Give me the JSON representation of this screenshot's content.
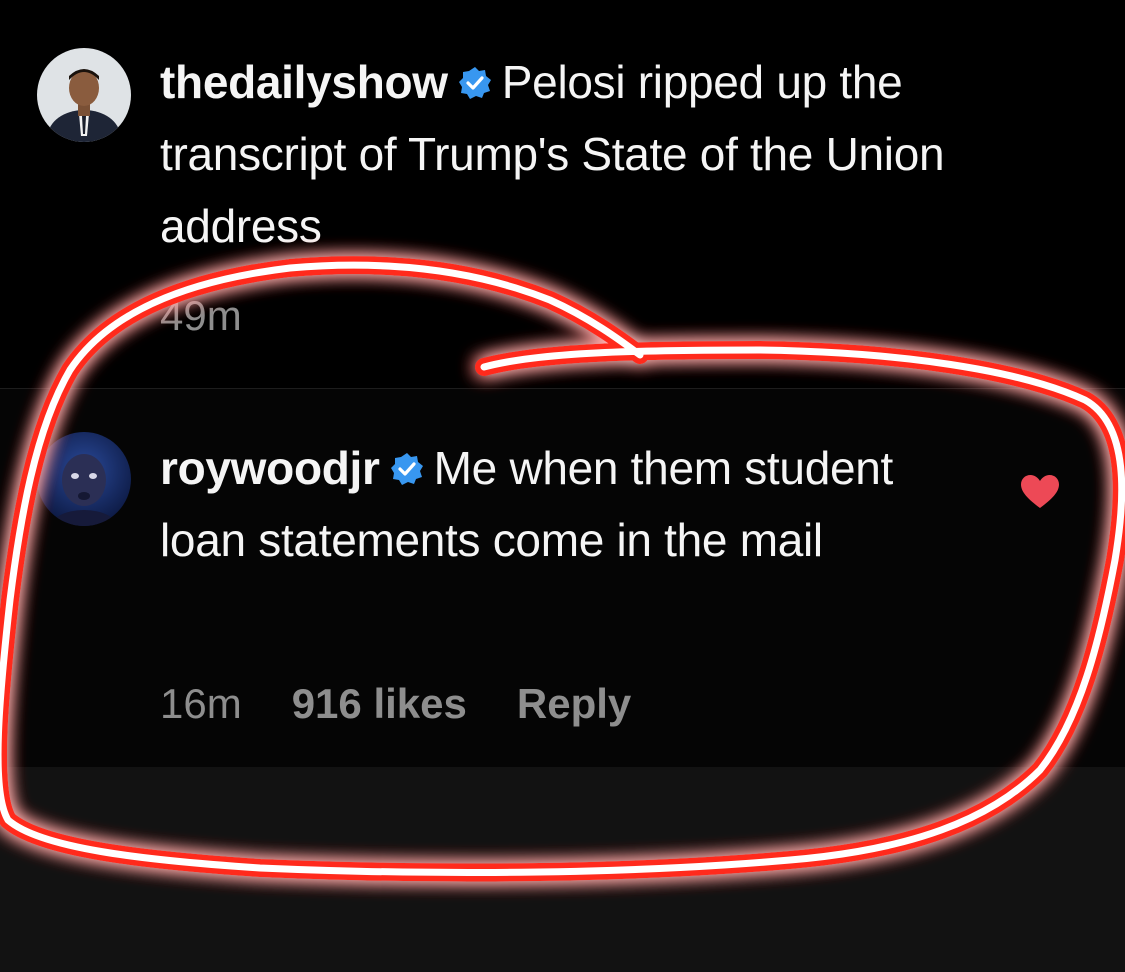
{
  "post_caption": {
    "username": "thedailyshow",
    "verified_icon": "verified-badge-icon",
    "text": "Pelosi ripped up the transcript of Trump's State of the Union address",
    "time": "49m"
  },
  "comment": {
    "username": "roywoodjr",
    "verified_icon": "verified-badge-icon",
    "text": "Me when them student loan statements come in the mail",
    "time": "16m",
    "likes": "916 likes",
    "reply_label": "Reply",
    "liked_icon": "heart-icon"
  },
  "colors": {
    "background": "#000000",
    "text": "#f5f5f5",
    "muted": "#8e8e8e",
    "verified": "#3897f0",
    "heart": "#ed4956",
    "annotation": "#ff2a1a"
  }
}
